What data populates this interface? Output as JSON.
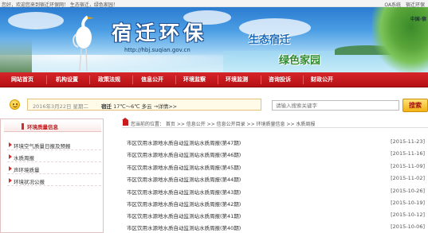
{
  "topbar": {
    "greeting": "您好，欢迎您来到宿迁环保网！ 生态宿迁，绿色家园！",
    "links": [
      "OA系统",
      "宿迁环保"
    ]
  },
  "banner": {
    "logo_title": "宿迁环保",
    "url": "http://hbj.suqian.gov.cn",
    "slogan_1": "生态宿迁",
    "slogan_2": "绿色家园",
    "corner_text": "中国·宿"
  },
  "nav": {
    "items": [
      "网站首页",
      "机构设置",
      "政策法规",
      "信息公开",
      "环境监察",
      "环境监测",
      "咨询投诉",
      "财政公开"
    ]
  },
  "infobar": {
    "date": "2016年3月22日 星期二",
    "city": "宿迁",
    "weather": "17℃～6℃ 多云",
    "weather_link": "详情",
    "search_placeholder": "请输入搜索关键字",
    "search_button": "搜索"
  },
  "sidebar": {
    "title": "环境质量信息",
    "items": [
      "环境空气质量日报及预报",
      "水质周报",
      "声环境质量",
      "环境状况公报"
    ]
  },
  "breadcrumb": {
    "text": "您当前的位置： 首页 >> 信息公开 >> 信息公开目录 >> 环境质量信息 >> 水质周报"
  },
  "news": [
    {
      "title": "市区饮用水源地水质自动监测站水质周报(第47期)",
      "date": "[2015-11-23]"
    },
    {
      "title": "市区饮用水源地水质自动监测站水质周报(第46期)",
      "date": "[2015-11-16]"
    },
    {
      "title": "市区饮用水源地水质自动监测站水质周报(第45期)",
      "date": "[2015-11-09]"
    },
    {
      "title": "市区饮用水源地水质自动监测站水质周报(第44期)",
      "date": "[2015-11-02]"
    },
    {
      "title": "市区饮用水源地水质自动监测站水质周报(第43期)",
      "date": "[2015-10-26]"
    },
    {
      "title": "市区饮用水源地水质自动监测站水质周报(第42期)",
      "date": "[2015-10-19]"
    },
    {
      "title": "市区饮用水源地水质自动监测站水质周报(第41期)",
      "date": "[2015-10-12]"
    },
    {
      "title": "市区饮用水源地水质自动监测站水质周报(第40期)",
      "date": "[2015-10-06]"
    }
  ],
  "colors": {
    "nav_red": "#c8191d",
    "accent_red": "#d42b2b",
    "search_button_yellow": "#f6c53b",
    "date_box_bg": "#fffbe8"
  }
}
